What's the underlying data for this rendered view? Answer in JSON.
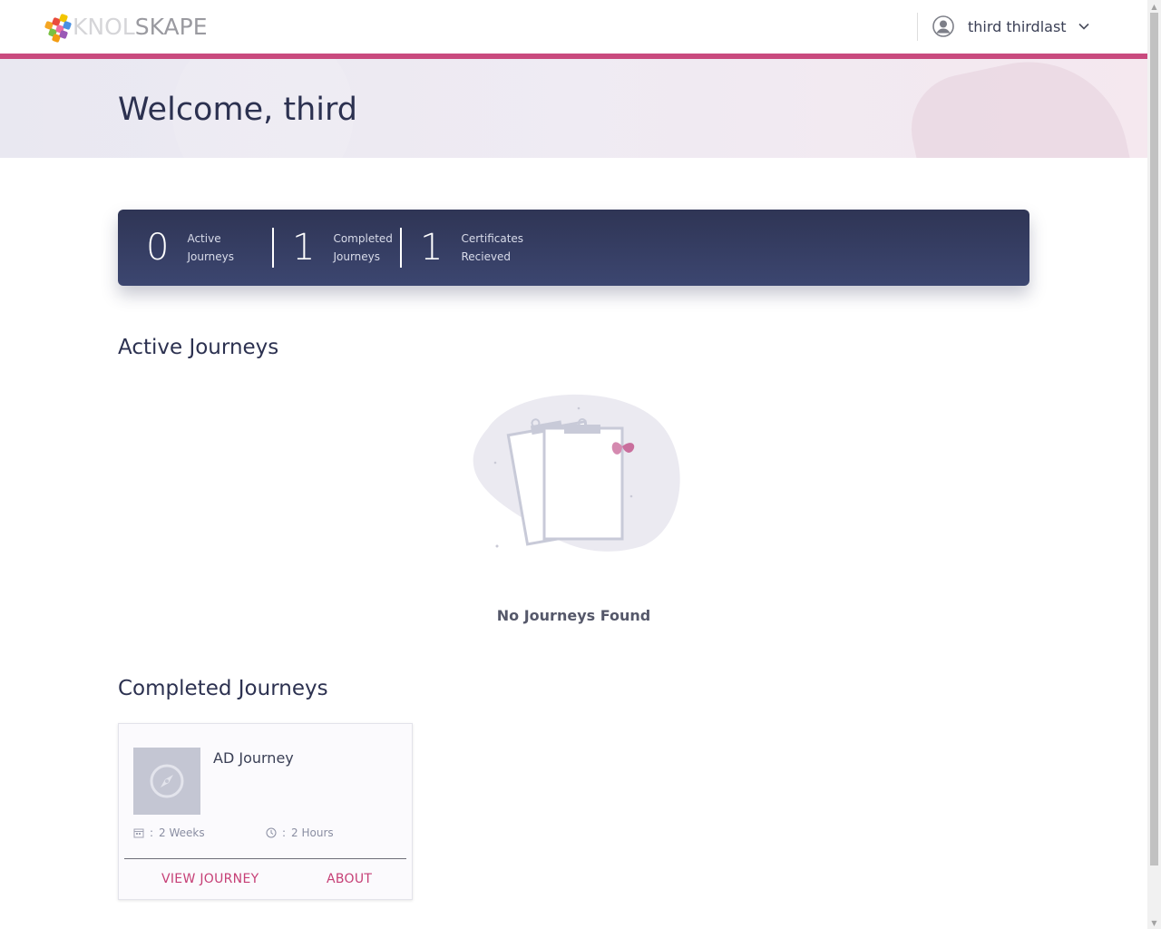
{
  "header": {
    "logo_text_light": "KNOL",
    "logo_text_dark": "SKAPE",
    "user_name": "third thirdlast"
  },
  "hero": {
    "welcome": "Welcome, third"
  },
  "stats": [
    {
      "value": "0",
      "label_line1": "Active",
      "label_line2": "Journeys"
    },
    {
      "value": "1",
      "label_line1": "Completed",
      "label_line2": "Journeys"
    },
    {
      "value": "1",
      "label_line1": "Certificates",
      "label_line2": "Recieved"
    }
  ],
  "active_section": {
    "title": "Active Journeys",
    "empty_message": "No Journeys Found"
  },
  "completed_section": {
    "title": "Completed Journeys",
    "cards": [
      {
        "title": "AD Journey",
        "duration": "2 Weeks",
        "time": "2 Hours",
        "view_label": "VIEW JOURNEY",
        "about_label": "ABOUT"
      }
    ]
  },
  "colors": {
    "accent": "#c94a7e",
    "stats_bg": "#2f3555",
    "link": "#c63f76"
  }
}
